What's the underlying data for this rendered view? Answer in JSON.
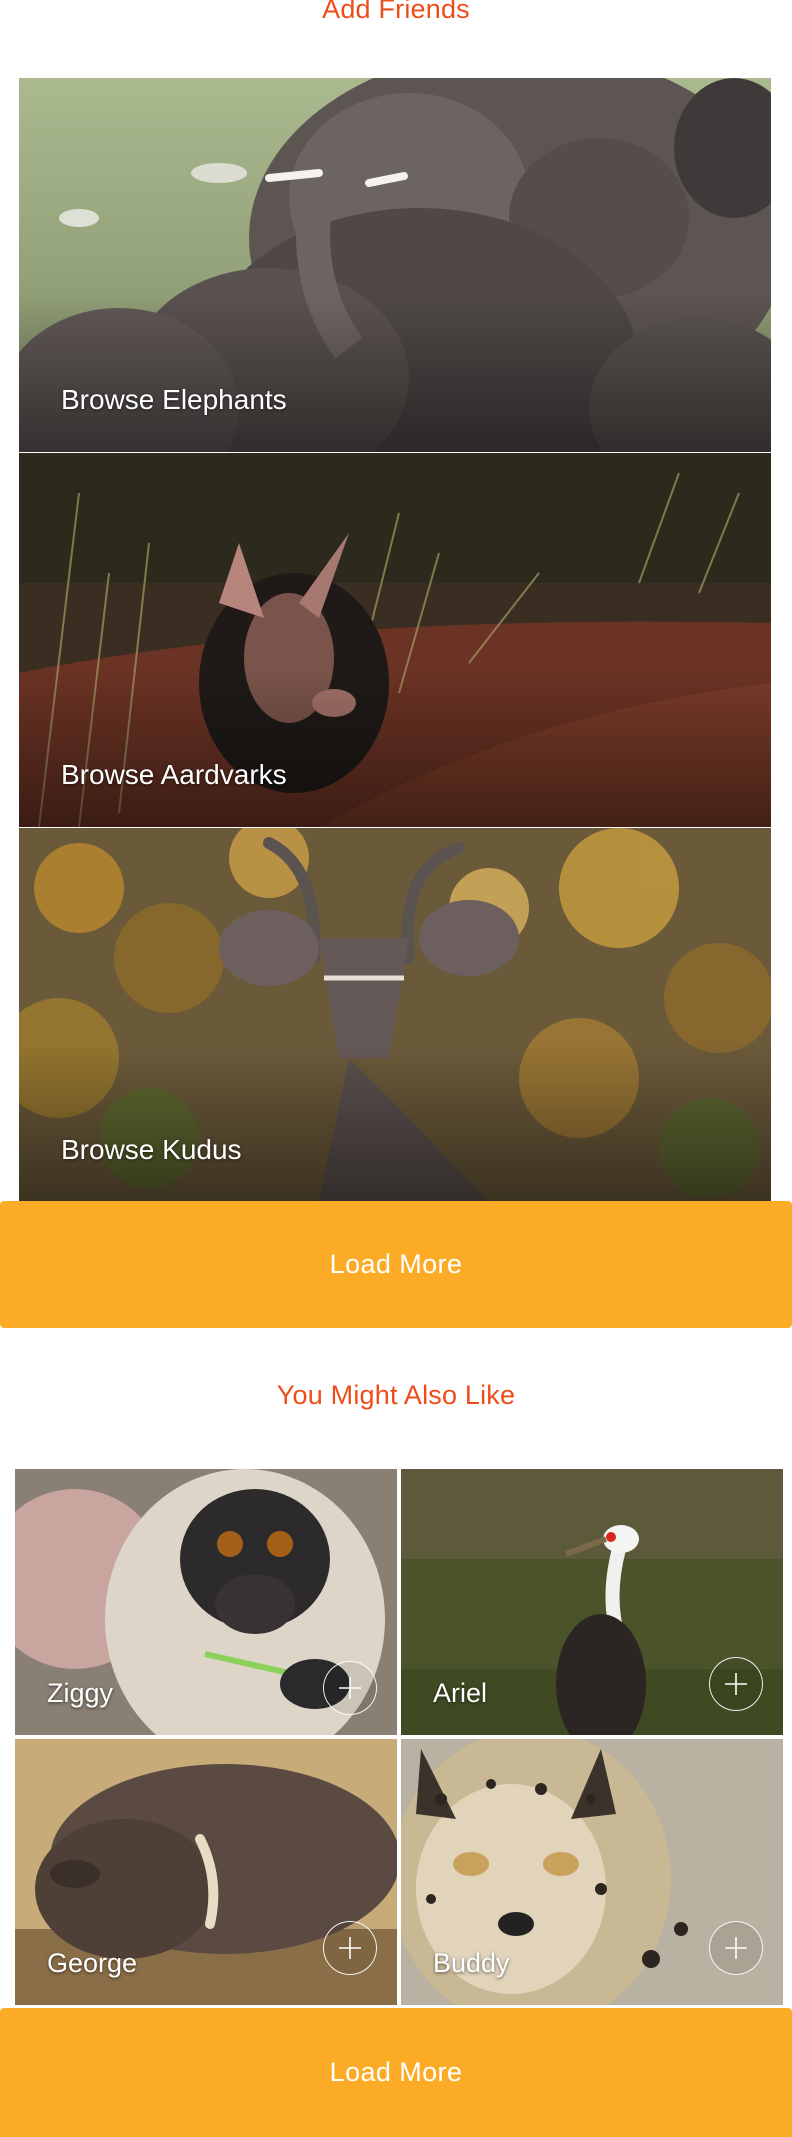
{
  "header": {
    "title": "Add Friends"
  },
  "browse": [
    {
      "label": "Browse Elephants"
    },
    {
      "label": "Browse Aardvarks"
    },
    {
      "label": "Browse Kudus"
    }
  ],
  "load_more_label": "Load More",
  "suggestions": {
    "title": "You Might Also Like",
    "animals": [
      {
        "name": "Ziggy"
      },
      {
        "name": "Ariel"
      },
      {
        "name": "George"
      },
      {
        "name": "Buddy"
      }
    ]
  },
  "colors": {
    "accent_text": "#ee4d1a",
    "button_bg": "#fbab26"
  },
  "icons": {
    "add": "plus-circle-icon"
  }
}
